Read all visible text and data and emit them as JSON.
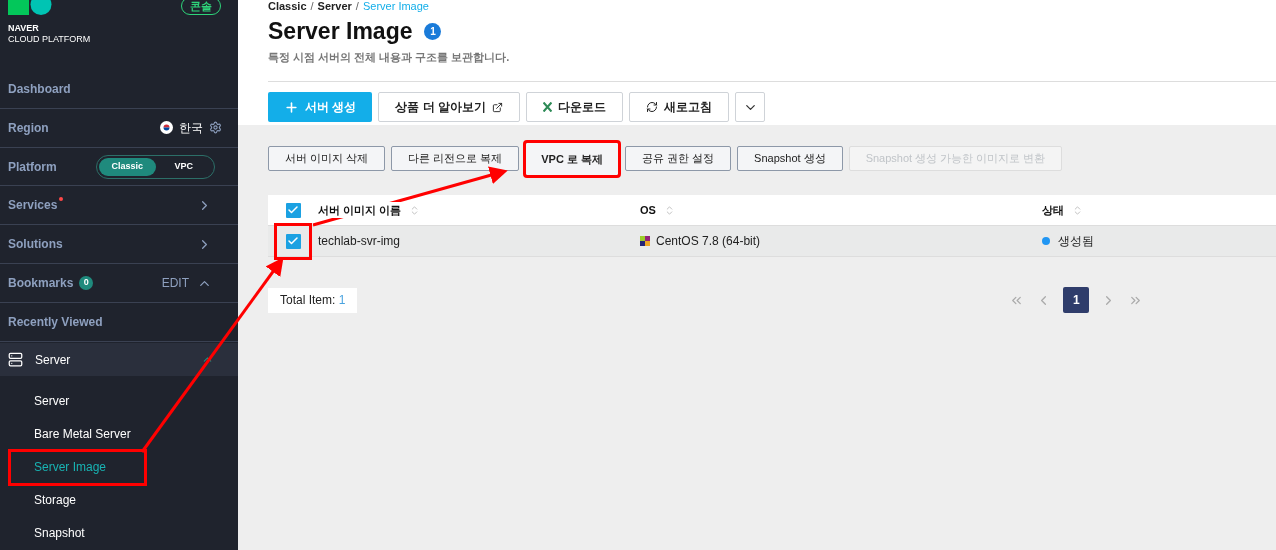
{
  "logo": {
    "line1": "NAVER",
    "line2": "CLOUD PLATFORM"
  },
  "console_badge": "콘솔",
  "sidebar": {
    "items": [
      {
        "kind": "link",
        "label": "Dashboard"
      },
      {
        "kind": "region",
        "label": "Region",
        "value": "한국"
      },
      {
        "kind": "platform",
        "label": "Platform",
        "options": [
          {
            "label": "Classic",
            "selected": true
          },
          {
            "label": "VPC",
            "selected": false
          }
        ]
      },
      {
        "kind": "menu",
        "label": "Services",
        "dot": true
      },
      {
        "kind": "menu",
        "label": "Solutions",
        "dot": false
      },
      {
        "kind": "bookmarks",
        "label": "Bookmarks",
        "count": "0",
        "action": "EDIT",
        "expanded": true
      },
      {
        "kind": "link",
        "label": "Recently Viewed"
      }
    ],
    "group": {
      "label": "Server",
      "expanded": true,
      "children": [
        {
          "label": "Server",
          "selected": false,
          "highlighted": false
        },
        {
          "label": "Bare Metal Server",
          "selected": false,
          "highlighted": false
        },
        {
          "label": "Server Image",
          "selected": true,
          "highlighted": true
        },
        {
          "label": "Storage",
          "selected": false,
          "highlighted": false
        },
        {
          "label": "Snapshot",
          "selected": false,
          "highlighted": false
        }
      ]
    }
  },
  "breadcrumb": [
    {
      "label": "Classic"
    },
    {
      "separator": "/",
      "label": "Server"
    },
    {
      "separator": "/",
      "label": "Server Image"
    }
  ],
  "title": "Server Image",
  "title_count": "1",
  "description": "특정 시점 서버의 전체 내용과 구조를 보관합니다.",
  "toolbar": [
    {
      "kind": "primary",
      "label": "서버 생성"
    },
    {
      "kind": "external",
      "label": "상품 더 알아보기"
    },
    {
      "kind": "excel",
      "label": "다운로드"
    },
    {
      "kind": "refresh",
      "label": "새로고침"
    },
    {
      "kind": "more"
    }
  ],
  "actions": [
    {
      "label": "서버 이미지 삭제",
      "disabled": false,
      "highlighted": false
    },
    {
      "label": "다른 리전으로 복제",
      "disabled": false,
      "highlighted": false
    },
    {
      "label": "VPC 로 복제",
      "disabled": false,
      "highlighted": true
    },
    {
      "label": "공유 권한 설정",
      "disabled": false,
      "highlighted": false
    },
    {
      "label": "Snapshot 생성",
      "disabled": false,
      "highlighted": false
    },
    {
      "label": "Snapshot 생성 가능한 이미지로 변환",
      "disabled": true,
      "highlighted": false
    }
  ],
  "table": {
    "all_checked": true,
    "columns": [
      {
        "label": "서버 이미지 이름"
      },
      {
        "label": "OS"
      },
      {
        "label": "상태"
      }
    ],
    "rows": [
      {
        "checked": true,
        "selected": true,
        "highlighted": true,
        "name": "techlab-svr-img",
        "os": "CentOS 7.8 (64-bit)",
        "status": "생성됨",
        "color": "#2196f3"
      }
    ]
  },
  "total": {
    "label": "Total Item:",
    "value": "1"
  },
  "pagination": {
    "pages": [
      {
        "label": "1",
        "selected": true
      }
    ]
  }
}
